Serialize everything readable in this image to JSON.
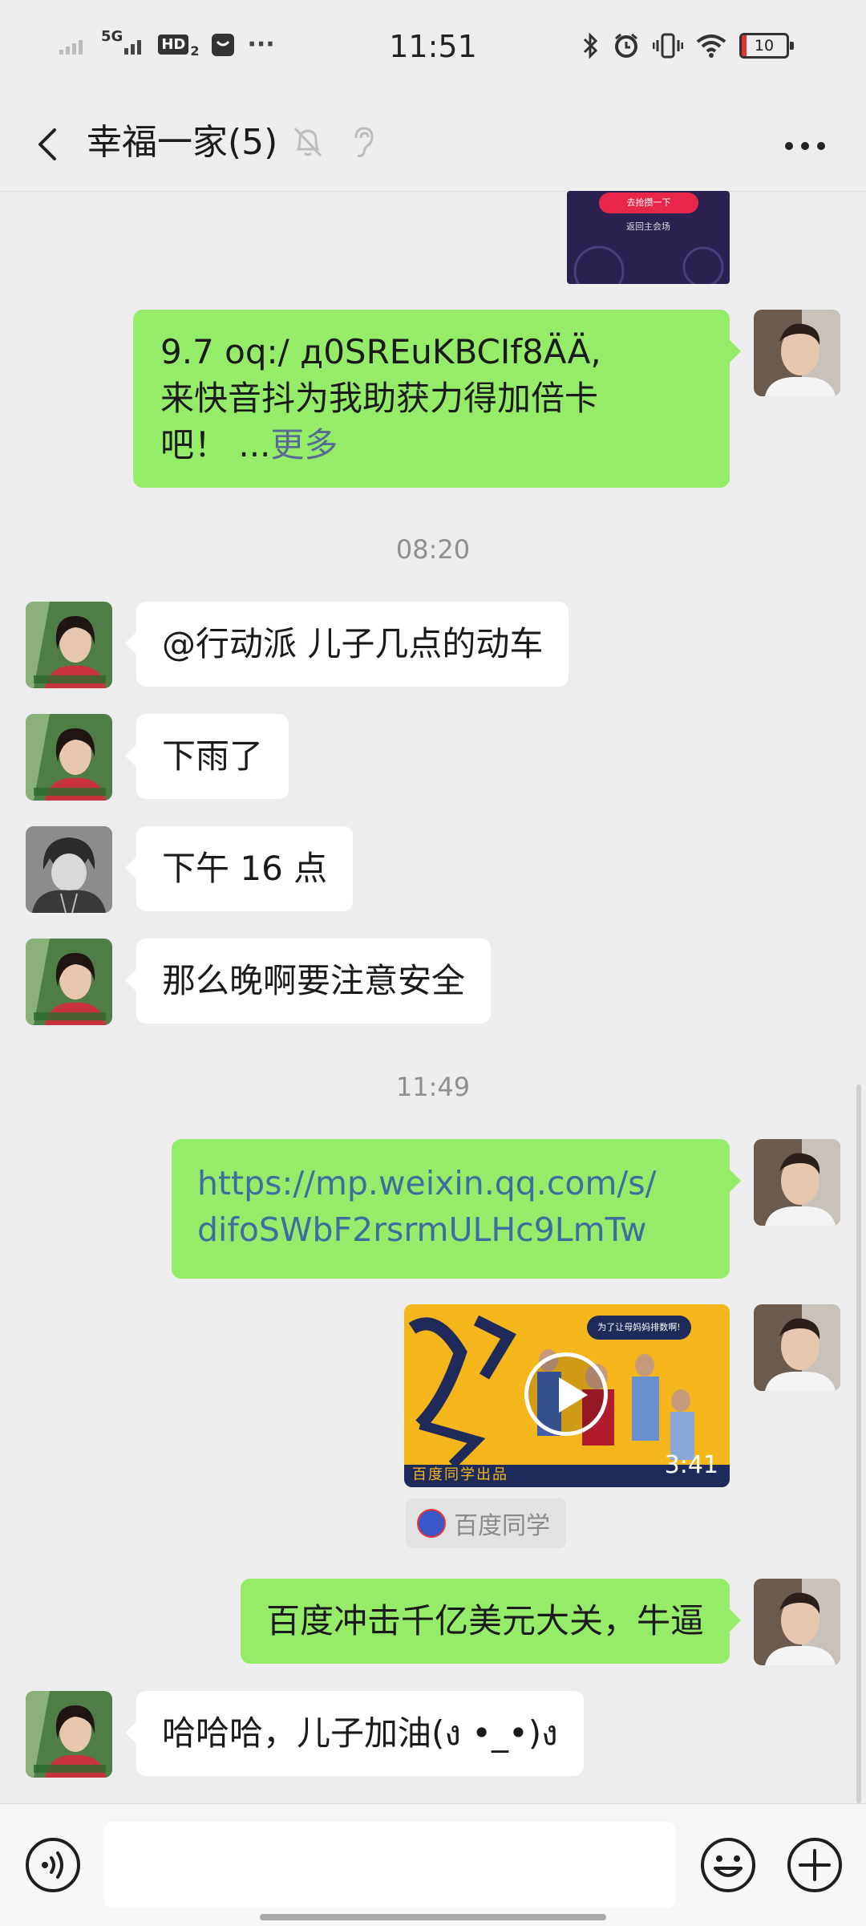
{
  "status_bar": {
    "time": "11:51",
    "network": "5G",
    "hd": "HD",
    "sim": "2",
    "more": "···",
    "battery": "10",
    "battery_level": 0.1,
    "battery_color": "#e33333"
  },
  "header": {
    "title": "幸福一家(5)",
    "icons": [
      "back-icon",
      "mute-bell-icon",
      "earpiece-icon",
      "more-icon"
    ]
  },
  "messages": [
    {
      "type": "card-thumb",
      "side": "right",
      "buttons": [
        "去抢攒一下",
        "返回主会场"
      ]
    },
    {
      "type": "text",
      "side": "right",
      "text_lines": [
        "9.7 oq:/ д0SREuKBCIf8ÄÄ,",
        "来快音抖为我助获力得加倍卡",
        "吧！ ..."
      ],
      "more": "更多"
    },
    {
      "type": "time",
      "text": "08:20"
    },
    {
      "type": "text",
      "side": "left",
      "sender": "mom",
      "text": "@行动派  儿子几点的动车"
    },
    {
      "type": "text",
      "side": "left",
      "sender": "mom",
      "text": "下雨了"
    },
    {
      "type": "text",
      "side": "left",
      "sender": "anime",
      "text": "下午 16 点"
    },
    {
      "type": "text",
      "side": "left",
      "sender": "mom",
      "text": "那么晚啊要注意安全"
    },
    {
      "type": "time",
      "text": "11:49"
    },
    {
      "type": "link",
      "side": "right",
      "text_lines": [
        "https://mp.weixin.qq.com/s/",
        "difoSWbF2rsrmULHc9LmTw"
      ]
    },
    {
      "type": "video",
      "side": "right",
      "duration": "3:41",
      "caption": "为了让母妈妈排数啊!",
      "footer": "百度同学出品",
      "source": "百度同学"
    },
    {
      "type": "text",
      "side": "right",
      "text": "百度冲击千亿美元大关，牛逼"
    },
    {
      "type": "text",
      "side": "left",
      "sender": "mom",
      "text": "哈哈哈，儿子加油(ง •_•)ง"
    }
  ],
  "input": {
    "value": "",
    "icons": [
      "voice-icon",
      "emoji-icon",
      "plus-icon"
    ]
  },
  "colors": {
    "green_bubble": "#95ec69",
    "white_bubble": "#ffffff",
    "link": "#576b95",
    "background": "#ededed"
  }
}
